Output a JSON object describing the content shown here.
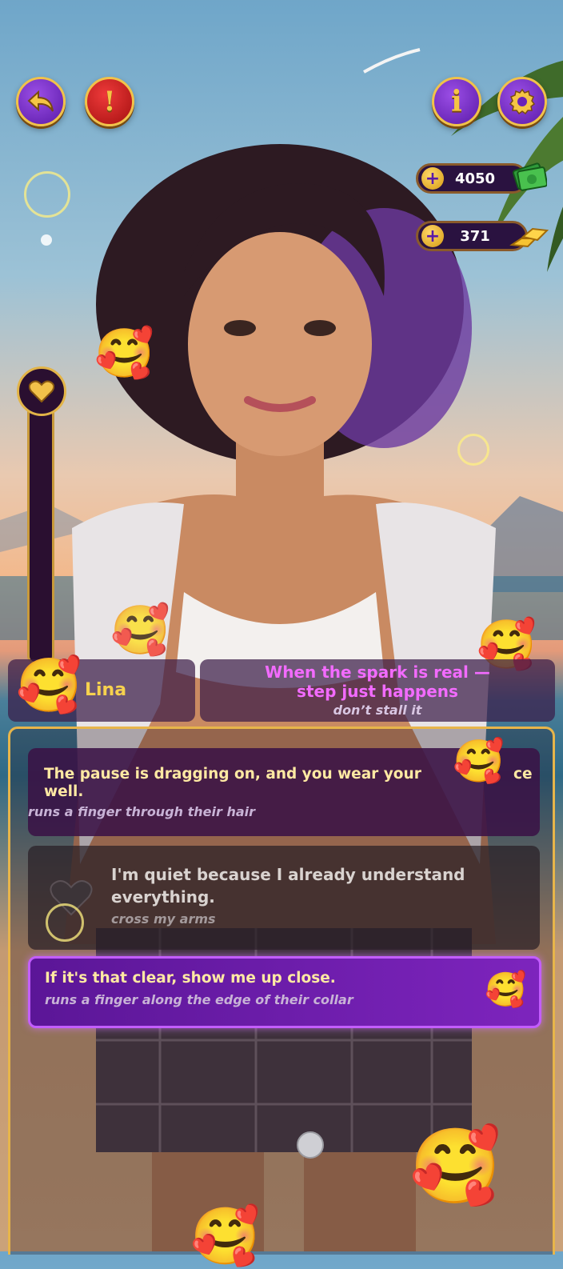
{
  "hud": {
    "back_icon": "undo-arrow-icon",
    "alert_icon": "exclamation-icon",
    "info_icon": "info-icon",
    "settings_icon": "gear-icon",
    "info_label": "i",
    "alert_label": "!"
  },
  "currency": {
    "cash": {
      "plus": "+",
      "value": "4050",
      "icon": "cash-icon"
    },
    "gold": {
      "plus": "+",
      "value": "371",
      "icon": "gold-bars-icon"
    }
  },
  "meter": {
    "icon": "heart-icon"
  },
  "dialogue": {
    "speaker": "Lina",
    "line1": "When the spark is real —",
    "line2": "step just happens",
    "action": "don’t stall it"
  },
  "choices": [
    {
      "text1": "The pause is dragging on, and you wear your",
      "text1b": "ce",
      "text2": "well.",
      "action": "runs a finger through their hair"
    },
    {
      "text1": "I'm quiet because I already understand",
      "text2": "everything.",
      "action": "cross my arms"
    },
    {
      "text1": "If it's that clear, show me up close.",
      "action": "runs a finger along the edge of their collar"
    }
  ],
  "colors": {
    "accent_gold": "#f1c24a",
    "button_purple": "#6a22b8",
    "alert_red": "#c81d1d",
    "speech_pink": "#f36bff",
    "selected_choice": "#7d24bd"
  }
}
